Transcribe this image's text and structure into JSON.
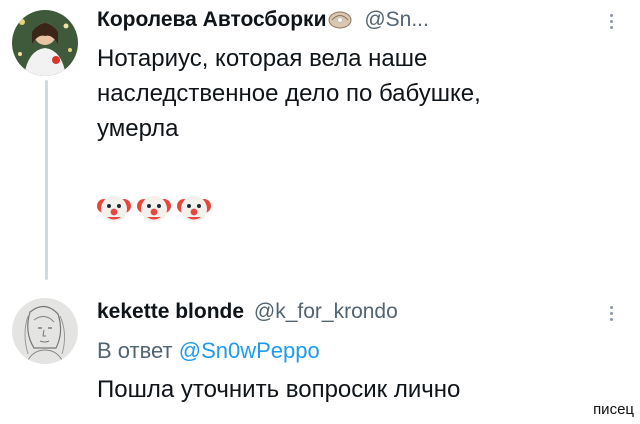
{
  "tweet1": {
    "display_name": "Королева Автосборки",
    "name_emoji": "oyster-emoji",
    "handle": "@Sn...",
    "text_lines": [
      "Нотариус, которая вела наше",
      "наследственное дело по бабушке,",
      "умерла"
    ],
    "emoji": [
      "clown-face",
      "clown-face",
      "clown-face"
    ]
  },
  "tweet2": {
    "display_name": "kekette blonde",
    "handle": "@k_for_krondo",
    "reply_prefix": "В ответ",
    "reply_mention": "@Sn0wPeppo",
    "text": "Пошла уточнить вопросик лично"
  },
  "watermark": "писец",
  "colors": {
    "text": "#0f1419",
    "secondary": "#536471",
    "mention": "#1d9bf0",
    "thread_line": "#cfd9de"
  }
}
